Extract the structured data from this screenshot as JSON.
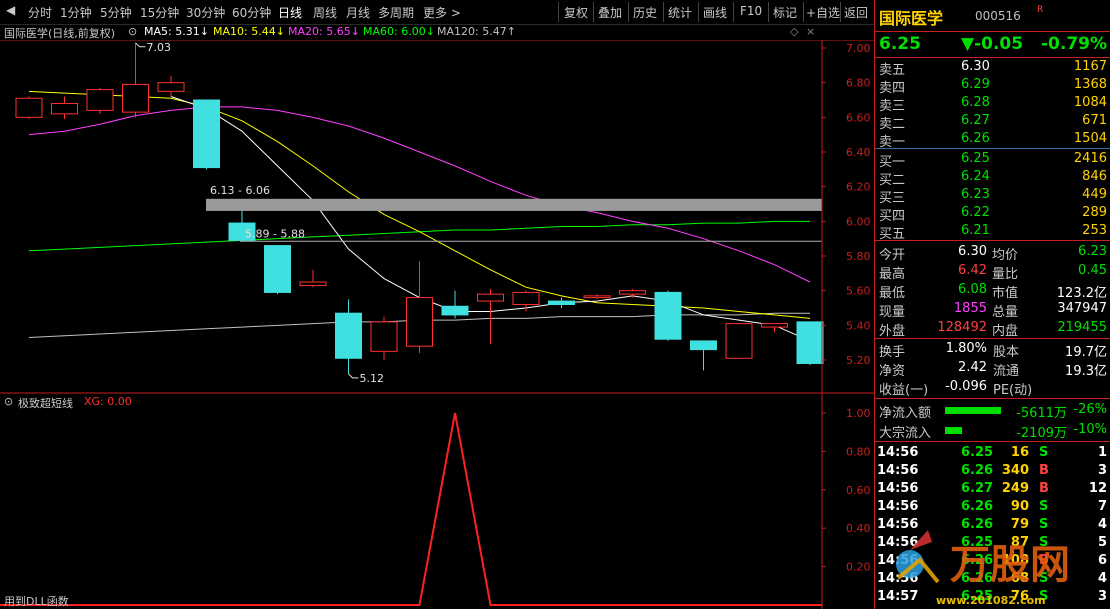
{
  "toolbar": {
    "left_items": [
      "分时",
      "1分钟",
      "5分钟",
      "15分钟",
      "30分钟",
      "60分钟",
      "日线",
      "周线",
      "月线",
      "多周期",
      "更多 >"
    ],
    "active": "日线",
    "right_items": [
      "复权",
      "叠加",
      "历史",
      "统计",
      "画线",
      "F10",
      "标记",
      "+自选",
      "返回"
    ]
  },
  "legend": {
    "title": "国际医学(日线,前复权)",
    "ma5": "MA5: 5.31↓",
    "ma10": "MA10: 5.44↓",
    "ma20": "MA20: 5.65↓",
    "ma60": "MA60: 6.00↓",
    "ma120": "MA120: 5.47↑",
    "ma5_color": "#ffffff",
    "ma10_color": "#ffff00",
    "ma20_color": "#ff40ff",
    "ma60_color": "#00ff00",
    "ma120_color": "#c0c0c0"
  },
  "price_axis": {
    "ticks": [
      "7.00",
      "6.80",
      "6.60",
      "6.40",
      "6.20",
      "6.00",
      "5.80",
      "5.60",
      "5.40",
      "5.20"
    ]
  },
  "chart_annotations": {
    "high_label": "7.03",
    "low_label": "5.12",
    "gap1_label": "6.13 - 6.06",
    "gap2_label": "5.89 - 5.88"
  },
  "chart_data": {
    "type": "candlestick",
    "ylim": [
      5.1,
      7.1
    ],
    "candles": [
      {
        "o": 6.6,
        "c": 6.71,
        "h": 6.72,
        "l": 6.59
      },
      {
        "o": 6.62,
        "c": 6.68,
        "h": 6.72,
        "l": 6.59
      },
      {
        "o": 6.64,
        "c": 6.76,
        "h": 6.77,
        "l": 6.62
      },
      {
        "o": 6.63,
        "c": 6.79,
        "h": 7.03,
        "l": 6.6
      },
      {
        "o": 6.75,
        "c": 6.8,
        "h": 6.84,
        "l": 6.72
      },
      {
        "o": 6.7,
        "c": 6.31,
        "h": 6.7,
        "l": 6.3
      },
      {
        "o": 5.99,
        "c": 5.89,
        "h": 6.06,
        "l": 5.88
      },
      {
        "o": 5.86,
        "c": 5.59,
        "h": 5.86,
        "l": 5.58
      },
      {
        "o": 5.63,
        "c": 5.65,
        "h": 5.72,
        "l": 5.62
      },
      {
        "o": 5.47,
        "c": 5.21,
        "h": 5.55,
        "l": 5.12
      },
      {
        "o": 5.25,
        "c": 5.42,
        "h": 5.45,
        "l": 5.2
      },
      {
        "o": 5.28,
        "c": 5.56,
        "h": 5.77,
        "l": 5.24
      },
      {
        "o": 5.51,
        "c": 5.46,
        "h": 5.6,
        "l": 5.44
      },
      {
        "o": 5.54,
        "c": 5.58,
        "h": 5.61,
        "l": 5.29
      },
      {
        "o": 5.52,
        "c": 5.59,
        "h": 5.6,
        "l": 5.48
      },
      {
        "o": 5.54,
        "c": 5.52,
        "h": 5.56,
        "l": 5.5
      },
      {
        "o": 5.56,
        "c": 5.57,
        "h": 5.58,
        "l": 5.55
      },
      {
        "o": 5.58,
        "c": 5.6,
        "h": 5.61,
        "l": 5.56
      },
      {
        "o": 5.59,
        "c": 5.32,
        "h": 5.6,
        "l": 5.31
      },
      {
        "o": 5.31,
        "c": 5.26,
        "h": 5.31,
        "l": 5.14
      },
      {
        "o": 5.21,
        "c": 5.41,
        "h": 5.41,
        "l": 5.21
      },
      {
        "o": 5.39,
        "c": 5.41,
        "h": 5.41,
        "l": 5.36
      },
      {
        "o": 5.42,
        "c": 5.18,
        "h": 5.42,
        "l": 5.17
      }
    ],
    "ma5": [
      null,
      null,
      null,
      null,
      6.72,
      6.65,
      6.52,
      6.32,
      6.12,
      5.84,
      5.67,
      5.56,
      5.48,
      5.48,
      5.5,
      5.53,
      5.54,
      5.57,
      5.54,
      5.46,
      5.43,
      5.4,
      5.31
    ],
    "ma10": [
      6.75,
      6.74,
      6.73,
      6.72,
      6.71,
      6.66,
      6.58,
      6.46,
      6.32,
      6.17,
      6.04,
      5.94,
      5.83,
      5.72,
      5.62,
      5.57,
      5.53,
      5.52,
      5.51,
      5.5,
      5.48,
      5.46,
      5.44
    ],
    "ma20": [
      6.5,
      6.52,
      6.56,
      6.61,
      6.64,
      6.66,
      6.66,
      6.64,
      6.6,
      6.55,
      6.48,
      6.4,
      6.32,
      6.23,
      6.15,
      6.09,
      6.05,
      6.0,
      5.96,
      5.9,
      5.83,
      5.75,
      5.65
    ],
    "ma60": [
      5.83,
      5.84,
      5.85,
      5.86,
      5.87,
      5.88,
      5.89,
      5.9,
      5.91,
      5.92,
      5.93,
      5.94,
      5.95,
      5.95,
      5.96,
      5.97,
      5.97,
      5.98,
      5.98,
      5.99,
      5.99,
      6.0,
      6.0
    ],
    "ma120": [
      5.33,
      5.34,
      5.35,
      5.36,
      5.37,
      5.38,
      5.39,
      5.4,
      5.41,
      5.42,
      5.42,
      5.43,
      5.43,
      5.44,
      5.44,
      5.45,
      5.45,
      5.45,
      5.46,
      5.46,
      5.46,
      5.47,
      5.47
    ]
  },
  "indicator": {
    "name": "极致超短线",
    "xg_label": "XG: 0.00",
    "footer": "用到DLL函数",
    "ticks": [
      "1.00",
      "0.80",
      "0.60",
      "0.40",
      "0.20"
    ],
    "values": [
      0,
      0,
      0,
      0,
      0,
      0,
      0,
      0,
      0,
      0,
      0,
      0,
      1,
      0,
      0,
      0,
      0,
      0,
      0,
      0,
      0,
      0,
      0
    ]
  },
  "quote": {
    "name": "国际医学",
    "code": "000516",
    "flag": "R",
    "price": "6.25",
    "change": "▼-0.05",
    "pct": "-0.79%",
    "sell": [
      {
        "label": "卖五",
        "price": "6.30",
        "vol": "1167"
      },
      {
        "label": "卖四",
        "price": "6.29",
        "vol": "1368"
      },
      {
        "label": "卖三",
        "price": "6.28",
        "vol": "1084"
      },
      {
        "label": "卖二",
        "price": "6.27",
        "vol": "671"
      },
      {
        "label": "卖一",
        "price": "6.26",
        "vol": "1504"
      }
    ],
    "buy": [
      {
        "label": "买一",
        "price": "6.25",
        "vol": "2416"
      },
      {
        "label": "买二",
        "price": "6.24",
        "vol": "846"
      },
      {
        "label": "买三",
        "price": "6.23",
        "vol": "449"
      },
      {
        "label": "买四",
        "price": "6.22",
        "vol": "289"
      },
      {
        "label": "买五",
        "price": "6.21",
        "vol": "253"
      }
    ],
    "stats": [
      {
        "l1": "今开",
        "v1": "6.30",
        "l2": "均价",
        "v2": "6.23"
      },
      {
        "l1": "最高",
        "v1": "6.42",
        "l2": "量比",
        "v2": "0.45"
      },
      {
        "l1": "最低",
        "v1": "6.08",
        "l2": "市值",
        "v2": "123.2亿"
      },
      {
        "l1": "现量",
        "v1": "1855",
        "l2": "总量",
        "v2": "347947"
      },
      {
        "l1": "外盘",
        "v1": "128492",
        "l2": "内盘",
        "v2": "219455"
      }
    ],
    "fund": [
      {
        "l1": "换手",
        "v1": "1.80%",
        "l2": "股本",
        "v2": "19.7亿"
      },
      {
        "l1": "净资",
        "v1": "2.42",
        "l2": "流通",
        "v2": "19.3亿"
      },
      {
        "l1": "收益(一)",
        "v1": "-0.096",
        "l2": "PE(动)",
        "v2": ""
      }
    ],
    "flow": [
      {
        "label": "净流入额",
        "value": "-5611万",
        "pct": "-26%",
        "bar": 1.0
      },
      {
        "label": "大宗流入",
        "value": "-2109万",
        "pct": "-10%",
        "bar": 0.3
      }
    ],
    "ticks": [
      {
        "time": "14:56",
        "price": "6.25",
        "vol": "16",
        "side": "S",
        "n": "1"
      },
      {
        "time": "14:56",
        "price": "6.26",
        "vol": "340",
        "side": "B",
        "n": "3"
      },
      {
        "time": "14:56",
        "price": "6.27",
        "vol": "249",
        "side": "B",
        "n": "12"
      },
      {
        "time": "14:56",
        "price": "6.26",
        "vol": "90",
        "side": "S",
        "n": "7"
      },
      {
        "time": "14:56",
        "price": "6.26",
        "vol": "79",
        "side": "S",
        "n": "4"
      },
      {
        "time": "14:56",
        "price": "6.25",
        "vol": "87",
        "side": "S",
        "n": "5"
      },
      {
        "time": "14:56",
        "price": "6.26",
        "vol": "108",
        "side": "B",
        "n": "6"
      },
      {
        "time": "14:56",
        "price": "6.26",
        "vol": "68",
        "side": "S",
        "n": "4"
      },
      {
        "time": "14:57",
        "price": "6.25",
        "vol": "76",
        "side": "S",
        "n": "3"
      }
    ]
  },
  "watermark": {
    "text": "万股网",
    "url": "www.201082.com"
  }
}
